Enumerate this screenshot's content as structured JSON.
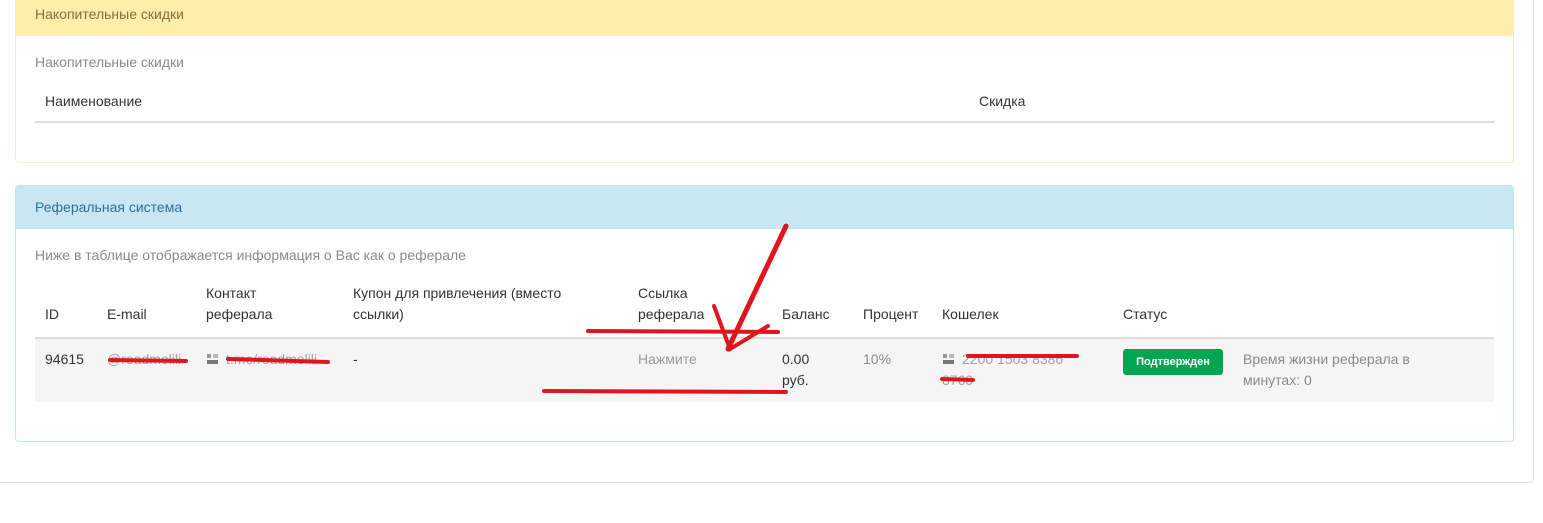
{
  "cumulative": {
    "heading": "Накопительные скидки",
    "description": "Накопительные скидки",
    "columns": [
      "Наименование",
      "Скидка"
    ]
  },
  "referral": {
    "heading": "Реферальная система",
    "description": "Ниже в таблице отображается информация о Вас как о реферале",
    "columns": {
      "id": "ID",
      "email": "E-mail",
      "contact_1": "Контакт",
      "contact_2": "реферала",
      "coupon_1": "Купон для привлечения (вместо",
      "coupon_2": "ссылки)",
      "link_1": "Ссылка",
      "link_2": "реферала",
      "balance": "Баланс",
      "percent": "Процент",
      "wallet": "Кошелек",
      "status": "Статус"
    },
    "row": {
      "id": "94615",
      "email": "@roadmelili",
      "contact": "t.me/roadmelili",
      "coupon": "-",
      "link": "Нажмите",
      "balance_1": "0.00",
      "balance_2": "руб.",
      "percent": "10%",
      "wallet_1": "2200 1503 8386",
      "wallet_2": "8760",
      "status": "Подтвержден",
      "lifetime_1": "Время жизни реферала в",
      "lifetime_2": "минутах: 0"
    }
  },
  "colors": {
    "warning_heading_bg": "#fdeeaa",
    "info_heading_bg": "#c9e6f5",
    "status_green": "#00a651",
    "annotation_red": "#e0161e"
  }
}
